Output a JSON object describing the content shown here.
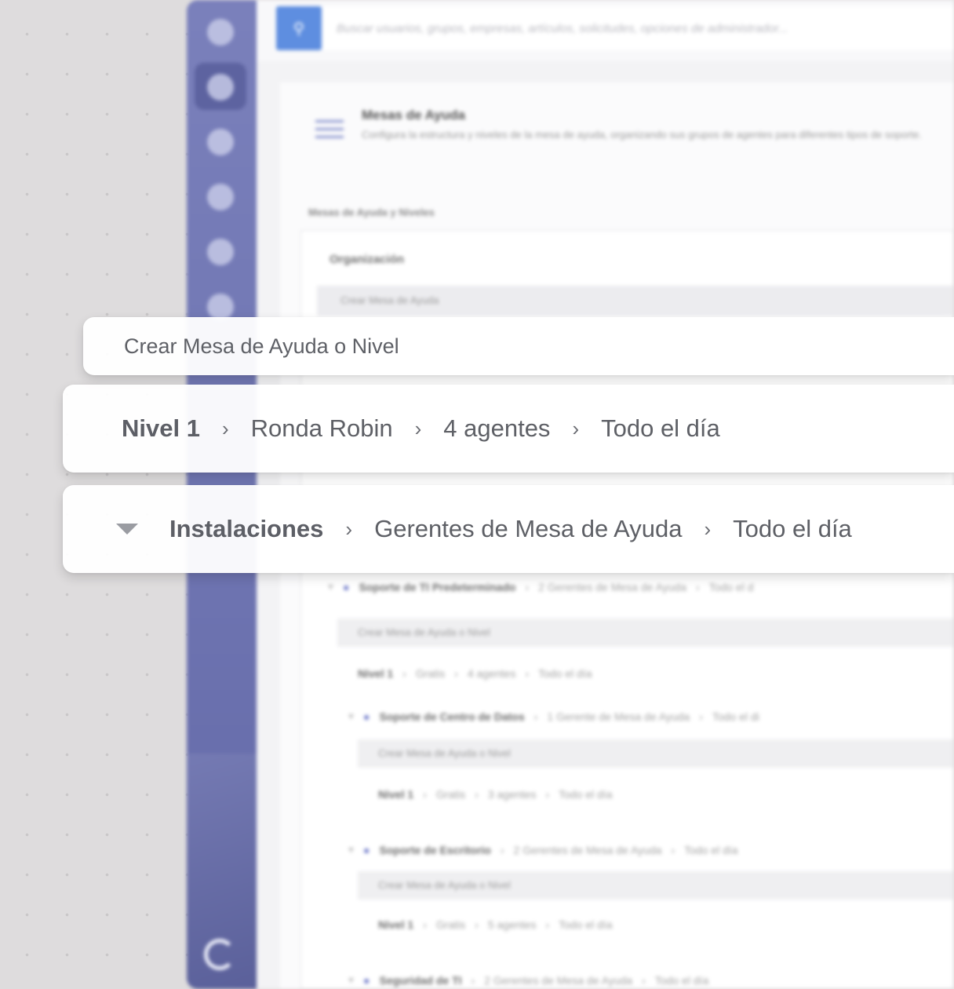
{
  "background_app": {
    "search": {
      "placeholder": "Buscar usuarios, grupos, empresas, artículos, solicitudes, opciones de administrador..."
    },
    "header": {
      "title": "Mesas de Ayuda",
      "description": "Configura la estructura y niveles de la mesa de ayuda, organizando sus grupos de agentes para diferentes tipos de soporte."
    },
    "section_label": "Mesas de Ayuda y Niveles",
    "tree": {
      "org_label": "Organización",
      "create_label": "Crear Mesa de Ayuda",
      "desks": [
        {
          "name": "Soporte de TI Predeterminado",
          "managers": "2 Gerentes de Mesa de Ayuda",
          "hours": "Todo el d",
          "create": "Crear Mesa de Ayuda o Nivel",
          "level": {
            "name": "Nivel 1",
            "mode": "Gratis",
            "agents": "4 agentes",
            "hours": "Todo el día"
          }
        },
        {
          "name": "Soporte de Centro de Datos",
          "managers": "1 Gerente de Mesa de Ayuda",
          "hours": "Todo el di",
          "create": "Crear Mesa de Ayuda o Nivel",
          "level": {
            "name": "Nivel 1",
            "mode": "Gratis",
            "agents": "3 agentes",
            "hours": "Todo el día"
          }
        },
        {
          "name": "Soporte de Escritorio",
          "managers": "2 Gerentes de Mesa de Ayuda",
          "hours": "Todo el día",
          "create": "Crear Mesa de Ayuda o Nivel",
          "level": {
            "name": "Nivel 1",
            "mode": "Gratis",
            "agents": "5 agentes",
            "hours": "Todo el día"
          }
        },
        {
          "name": "Seguridad de TI",
          "managers": "2 Gerentes de Mesa de Ayuda",
          "hours": "Todo el día"
        }
      ]
    }
  },
  "overlay": {
    "create_card": {
      "label": "Crear Mesa de Ayuda o Nivel"
    },
    "level_card": {
      "level": "Nivel 1",
      "mode": "Ronda Robin",
      "agents": "4 agentes",
      "hours": "Todo el día"
    },
    "desk_card": {
      "name": "Instalaciones",
      "managers": "Gerentes de Mesa de Ayuda",
      "hours": "Todo el día"
    },
    "separator": "›"
  },
  "colors": {
    "sidebar": "#6d73b0",
    "search_button": "#5e8ee0",
    "department_icon": "#6a75c7"
  }
}
